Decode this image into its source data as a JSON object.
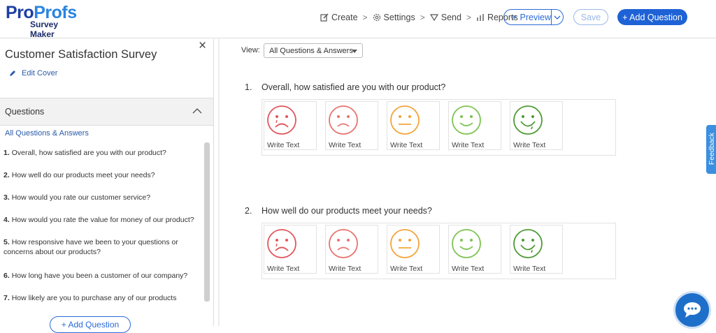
{
  "brand": {
    "logo_pro": "Pro",
    "logo_profs": "Profs",
    "logo_sub": "Survey Maker"
  },
  "nav": {
    "create": "Create",
    "settings": "Settings",
    "send": "Send",
    "reports": "Reports",
    "separator": ">"
  },
  "toolbar": {
    "preview_label": "Preview",
    "save_label": "Save",
    "add_question_label": "+ Add Question"
  },
  "sidebar": {
    "survey_title": "Customer Satisfaction Survey",
    "close_glyph": "×",
    "edit_cover_label": "Edit Cover",
    "questions_header": "Questions",
    "all_qa_link": "All Questions & Answers",
    "items": [
      {
        "num": "1.",
        "text": "Overall, how satisfied are you with our product?"
      },
      {
        "num": "2.",
        "text": "How well do our products meet your needs?"
      },
      {
        "num": "3.",
        "text": "How would you rate our customer service?"
      },
      {
        "num": "4.",
        "text": "How would you rate the value for money of our product?"
      },
      {
        "num": "5.",
        "text": "How responsive have we been to your questions or concerns about our products?"
      },
      {
        "num": "6.",
        "text": "How long have you been a customer of our company?"
      },
      {
        "num": "7.",
        "text": "How likely are you to purchase any of our products"
      }
    ],
    "add_question_label": "+ Add Question"
  },
  "main": {
    "view_label": "View:",
    "view_value": "All Questions & Answers",
    "questions": [
      {
        "num": "1.",
        "text": "Overall, how satisfied are you with our product?",
        "options": [
          {
            "label": "Write Text",
            "icon": "very-sad-face-icon",
            "color": "#e0565b"
          },
          {
            "label": "Write Text",
            "icon": "sad-face-icon",
            "color": "#e8736f"
          },
          {
            "label": "Write Text",
            "icon": "neutral-face-icon",
            "color": "#f2a43a"
          },
          {
            "label": "Write Text",
            "icon": "happy-face-icon",
            "color": "#7dc352"
          },
          {
            "label": "Write Text",
            "icon": "very-happy-face-icon",
            "color": "#4e9a36"
          }
        ]
      },
      {
        "num": "2.",
        "text": "How well do our products meet your needs?",
        "options": [
          {
            "label": "Write Text",
            "icon": "very-sad-face-icon",
            "color": "#e0565b"
          },
          {
            "label": "Write Text",
            "icon": "sad-face-icon",
            "color": "#e8736f"
          },
          {
            "label": "Write Text",
            "icon": "neutral-face-icon",
            "color": "#f2a43a"
          },
          {
            "label": "Write Text",
            "icon": "happy-face-icon",
            "color": "#7dc352"
          },
          {
            "label": "Write Text",
            "icon": "very-happy-face-icon",
            "color": "#4e9a36"
          }
        ]
      }
    ]
  },
  "feedback_label": "Feedback"
}
